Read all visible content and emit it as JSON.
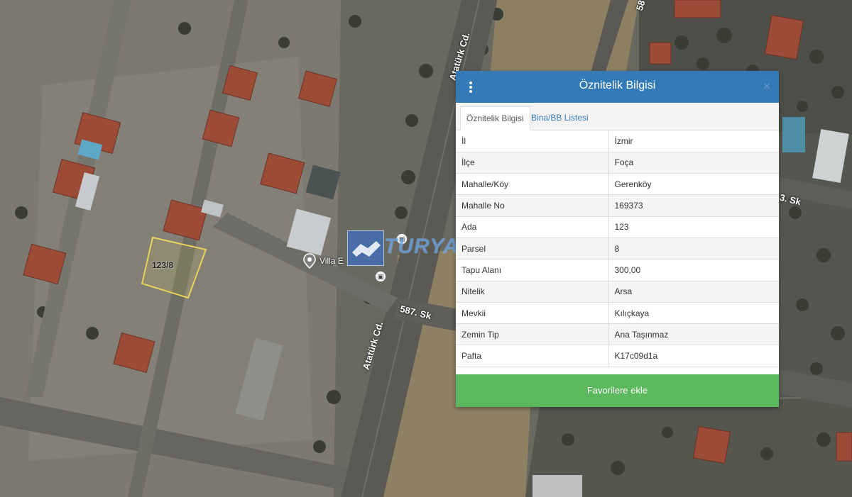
{
  "map": {
    "road_labels": [
      "Atatürk Cd.",
      "Atatürk Cd.",
      "587. Sk",
      "3. Sk",
      "58"
    ],
    "parcel_label": "123/8",
    "place_label": "Villa E",
    "place_pin_icon": "map-pin-icon",
    "bus_icon": "bus-stop-icon"
  },
  "watermark": {
    "text": "TURYAP"
  },
  "panel": {
    "title": "Öznitelik Bilgisi",
    "menu_icon": "vertical-dots-icon",
    "close_icon": "close-icon",
    "close_glyph": "×",
    "tabs": [
      {
        "label": "Öznitelik Bilgisi",
        "active": true
      },
      {
        "label": "Bina/BB Listesi",
        "active": false
      }
    ],
    "rows": [
      {
        "key": "İl",
        "value": "İzmir"
      },
      {
        "key": "İlçe",
        "value": "Foça"
      },
      {
        "key": "Mahalle/Köy",
        "value": "Gerenköy"
      },
      {
        "key": "Mahalle No",
        "value": "169373"
      },
      {
        "key": "Ada",
        "value": "123"
      },
      {
        "key": "Parsel",
        "value": "8"
      },
      {
        "key": "Tapu Alanı",
        "value": "300,00"
      },
      {
        "key": "Nitelik",
        "value": "Arsa"
      },
      {
        "key": "Mevkii",
        "value": "Kılıçkaya"
      },
      {
        "key": "Zemin Tip",
        "value": "Ana Taşınmaz"
      },
      {
        "key": "Pafta",
        "value": "K17c09d1a"
      }
    ],
    "favorite_button": "Favorilere ekle"
  },
  "colors": {
    "header": "#337ab7",
    "button": "#5cb85c",
    "parcel_outline": "#e5d35a"
  }
}
